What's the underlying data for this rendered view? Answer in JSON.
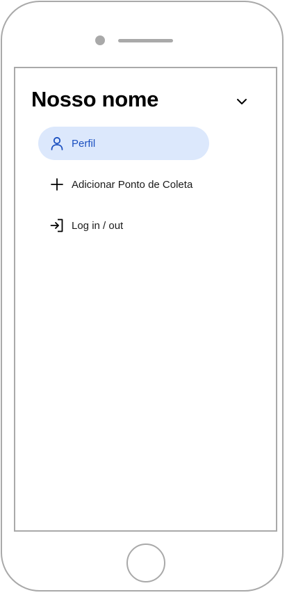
{
  "app": {
    "title": "Nosso nome"
  },
  "colors": {
    "frame": "#a9a9a9",
    "active_background": "#dce8fc",
    "active_accent": "#1a4fc0",
    "text": "#1a1a1a"
  },
  "drawer": {
    "collapse_icon": "chevron-down-icon",
    "items": [
      {
        "label": "Perfil",
        "icon": "person-icon",
        "active": true
      },
      {
        "label": "Adicionar Ponto de Coleta",
        "icon": "plus-icon",
        "active": false
      },
      {
        "label": "Log in / out",
        "icon": "login-icon",
        "active": false
      }
    ]
  }
}
